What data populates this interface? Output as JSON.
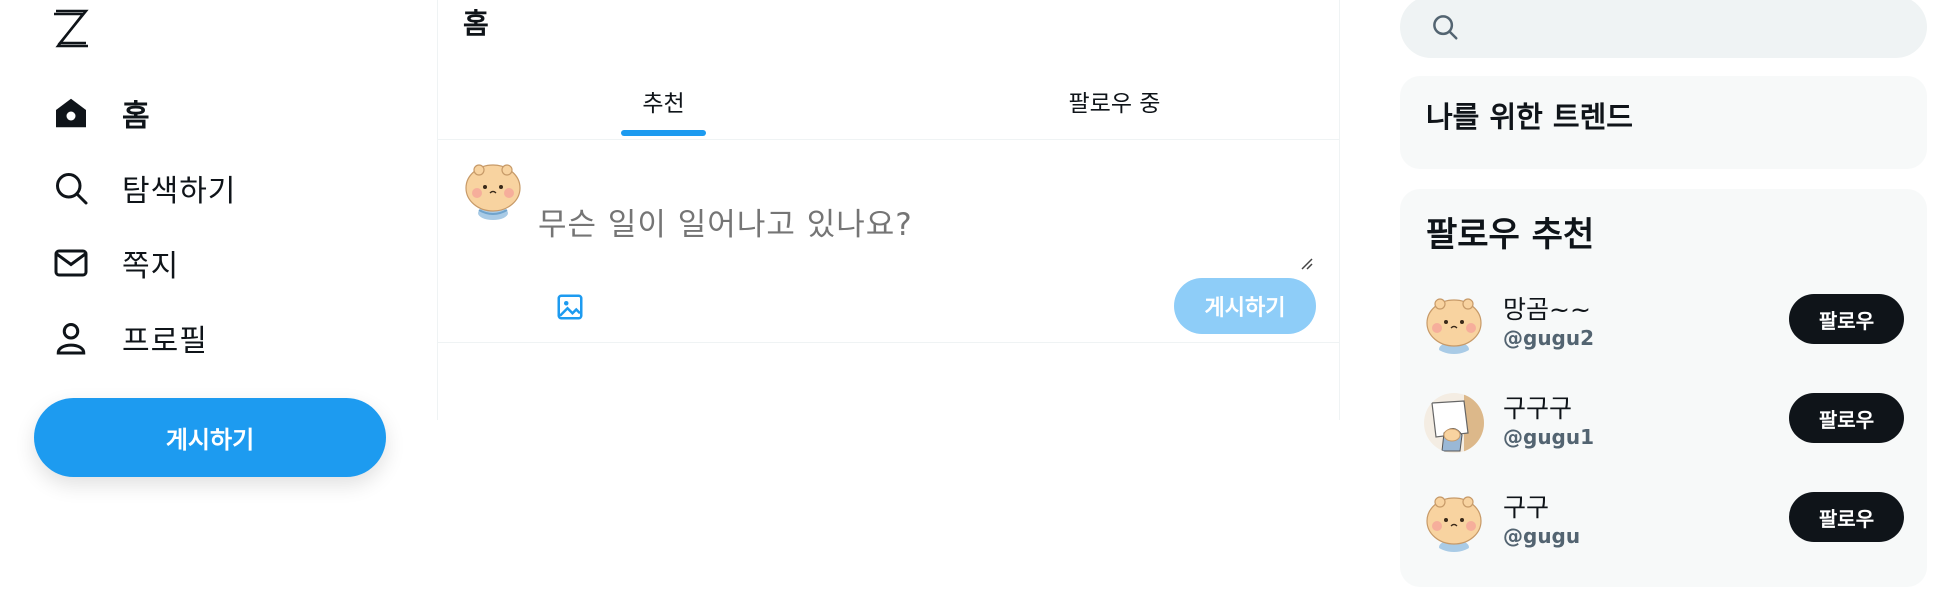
{
  "sidebar": {
    "logo_icon": "z-logo-icon",
    "items": [
      {
        "label": "홈",
        "icon": "home-icon",
        "active": true
      },
      {
        "label": "탐색하기",
        "icon": "search-icon",
        "active": false
      },
      {
        "label": "쪽지",
        "icon": "mail-icon",
        "active": false
      },
      {
        "label": "프로필",
        "icon": "user-icon",
        "active": false
      }
    ],
    "post_button_label": "게시하기"
  },
  "main": {
    "title": "홈",
    "tabs": [
      {
        "label": "추천",
        "active": true
      },
      {
        "label": "팔로우 중",
        "active": false
      }
    ],
    "composer": {
      "placeholder": "무슨 일이 일어나고 있나요?",
      "media_icon": "image-icon",
      "submit_label": "게시하기"
    }
  },
  "right": {
    "search_icon": "search-icon",
    "trends_title": "나를 위한 트렌드",
    "follow_title": "팔로우 추천",
    "follow_button_label": "팔로우",
    "users": [
      {
        "name": "망곰~~",
        "handle": "@gugu2",
        "avatar": "bear-avatar"
      },
      {
        "name": "구구구",
        "handle": "@gugu1",
        "avatar": "sketch-avatar"
      },
      {
        "name": "구구",
        "handle": "@gugu",
        "avatar": "bear-avatar"
      }
    ]
  },
  "colors": {
    "accent": "#1d9bf0",
    "accent_disabled": "#8ecdf8",
    "text": "#0f1419",
    "secondary_text": "#536471",
    "panel_bg": "#f7f9f9"
  }
}
